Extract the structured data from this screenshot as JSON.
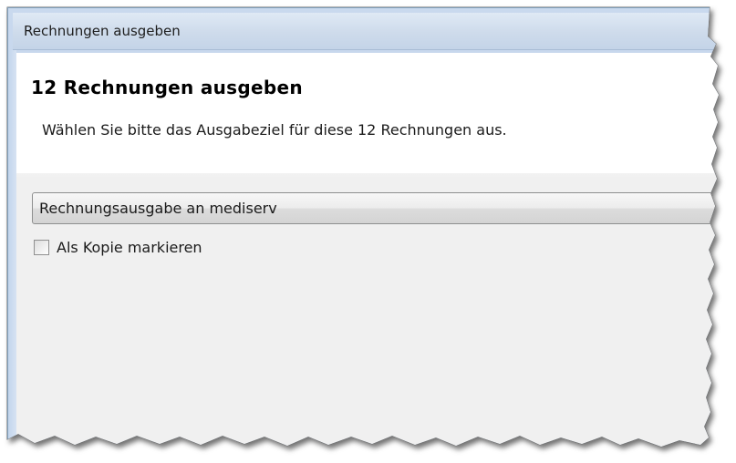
{
  "window": {
    "title": "Rechnungen ausgeben"
  },
  "header": {
    "heading": "12 Rechnungen ausgeben",
    "subtitle": "Wählen Sie bitte das Ausgabeziel für diese 12 Rechnungen aus."
  },
  "output_target": {
    "selected": "Rechnungsausgabe an mediserv"
  },
  "copy_option": {
    "label": "Als Kopie markieren",
    "checked": false
  },
  "colors": {
    "title_bar": "#cedbeb",
    "window_frame": "#7f9db9",
    "body_background": "#f0f0f0"
  }
}
